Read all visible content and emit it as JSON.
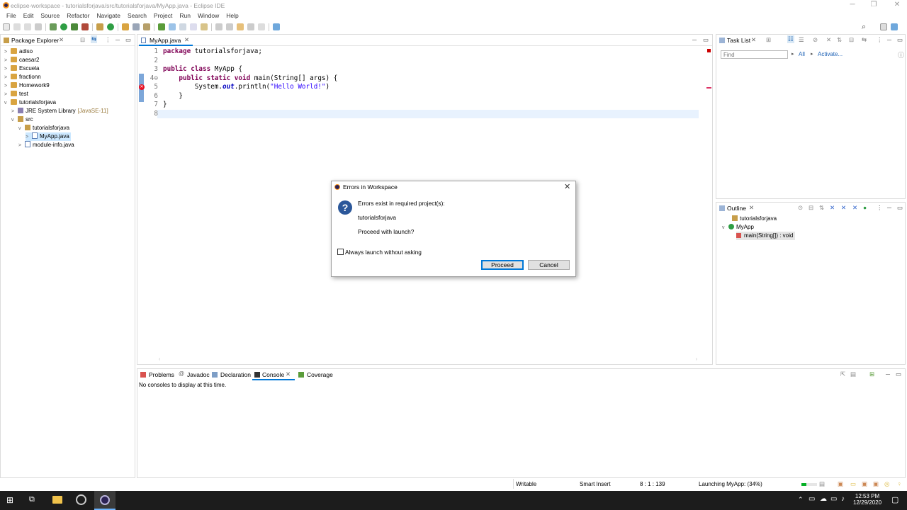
{
  "window": {
    "title": "eclipse-workspace - tutorialsforjava/src/tutorialsforjava/MyApp.java - Eclipse IDE"
  },
  "menu": [
    "File",
    "Edit",
    "Source",
    "Refactor",
    "Navigate",
    "Search",
    "Project",
    "Run",
    "Window",
    "Help"
  ],
  "package_explorer": {
    "title": "Package Explorer",
    "items": [
      {
        "label": "adiso",
        "indent": 0,
        "fold": ">"
      },
      {
        "label": "caesar2",
        "indent": 0,
        "fold": ">"
      },
      {
        "label": "Escuela",
        "indent": 0,
        "fold": ">"
      },
      {
        "label": "fractionn",
        "indent": 0,
        "fold": ">"
      },
      {
        "label": "Homework9",
        "indent": 0,
        "fold": ">"
      },
      {
        "label": "test",
        "indent": 0,
        "fold": ">"
      },
      {
        "label": "tutorialsforjava",
        "indent": 0,
        "fold": "v"
      },
      {
        "label": "JRE System Library",
        "suffix": "[JavaSE-11]",
        "indent": 1,
        "fold": ">"
      },
      {
        "label": "src",
        "indent": 1,
        "fold": "v"
      },
      {
        "label": "tutorialsforjava",
        "indent": 2,
        "fold": "v"
      },
      {
        "label": "MyApp.java",
        "indent": 3,
        "fold": ">",
        "selected": true
      },
      {
        "label": "module-info.java",
        "indent": 2,
        "fold": ">"
      }
    ]
  },
  "editor": {
    "tab": "MyApp.java",
    "lines": [
      {
        "n": "1",
        "segments": [
          {
            "t": "package",
            "c": "kw"
          },
          {
            "t": " tutorialsforjava;"
          }
        ]
      },
      {
        "n": "2",
        "segments": []
      },
      {
        "n": "3",
        "segments": [
          {
            "t": "public",
            "c": "kw"
          },
          {
            "t": " "
          },
          {
            "t": "class",
            "c": "kw"
          },
          {
            "t": " MyApp {"
          }
        ]
      },
      {
        "n": "4⊖",
        "segments": [
          {
            "t": "    "
          },
          {
            "t": "public",
            "c": "kw"
          },
          {
            "t": " "
          },
          {
            "t": "static",
            "c": "kw"
          },
          {
            "t": " "
          },
          {
            "t": "void",
            "c": "kw"
          },
          {
            "t": " main(String[] args) {"
          }
        ]
      },
      {
        "n": "5",
        "segments": [
          {
            "t": "        System."
          },
          {
            "t": "out",
            "c": "it"
          },
          {
            "t": ".println("
          },
          {
            "t": "\"Hello World!\"",
            "c": "str"
          },
          {
            "t": ")"
          }
        ]
      },
      {
        "n": "6",
        "segments": [
          {
            "t": "    }"
          }
        ]
      },
      {
        "n": "7",
        "segments": [
          {
            "t": "}"
          }
        ]
      },
      {
        "n": "8",
        "segments": []
      }
    ]
  },
  "task_list": {
    "title": "Task List",
    "find_placeholder": "Find",
    "all": "All",
    "activate": "Activate..."
  },
  "outline": {
    "title": "Outline",
    "items": [
      {
        "label": "tutorialsforjava"
      },
      {
        "label": "MyApp"
      },
      {
        "label": "main(String[]) : void"
      }
    ]
  },
  "bottom": {
    "tabs": [
      "Problems",
      "Javadoc",
      "Declaration",
      "Console",
      "Coverage"
    ],
    "message": "No consoles to display at this time."
  },
  "dialog": {
    "title": "Errors in Workspace",
    "message": "Errors exist in required project(s):",
    "project": "tutorialsforjava",
    "question": "Proceed with launch?",
    "checkbox": "Always launch without asking",
    "proceed": "Proceed",
    "cancel": "Cancel"
  },
  "status": {
    "writable": "Writable",
    "insert": "Smart Insert",
    "position": "8 : 1 : 139",
    "launching": "Launching MyApp: (34%)",
    "progress": 0.34
  },
  "clock": {
    "time": "12:53 PM",
    "date": "12/29/2020"
  },
  "colors": {
    "accent": "#0078d7",
    "selection": "#cce8ff",
    "error": "#e81123",
    "taskbar": "#1c1c1c",
    "progress": "#06b025"
  }
}
